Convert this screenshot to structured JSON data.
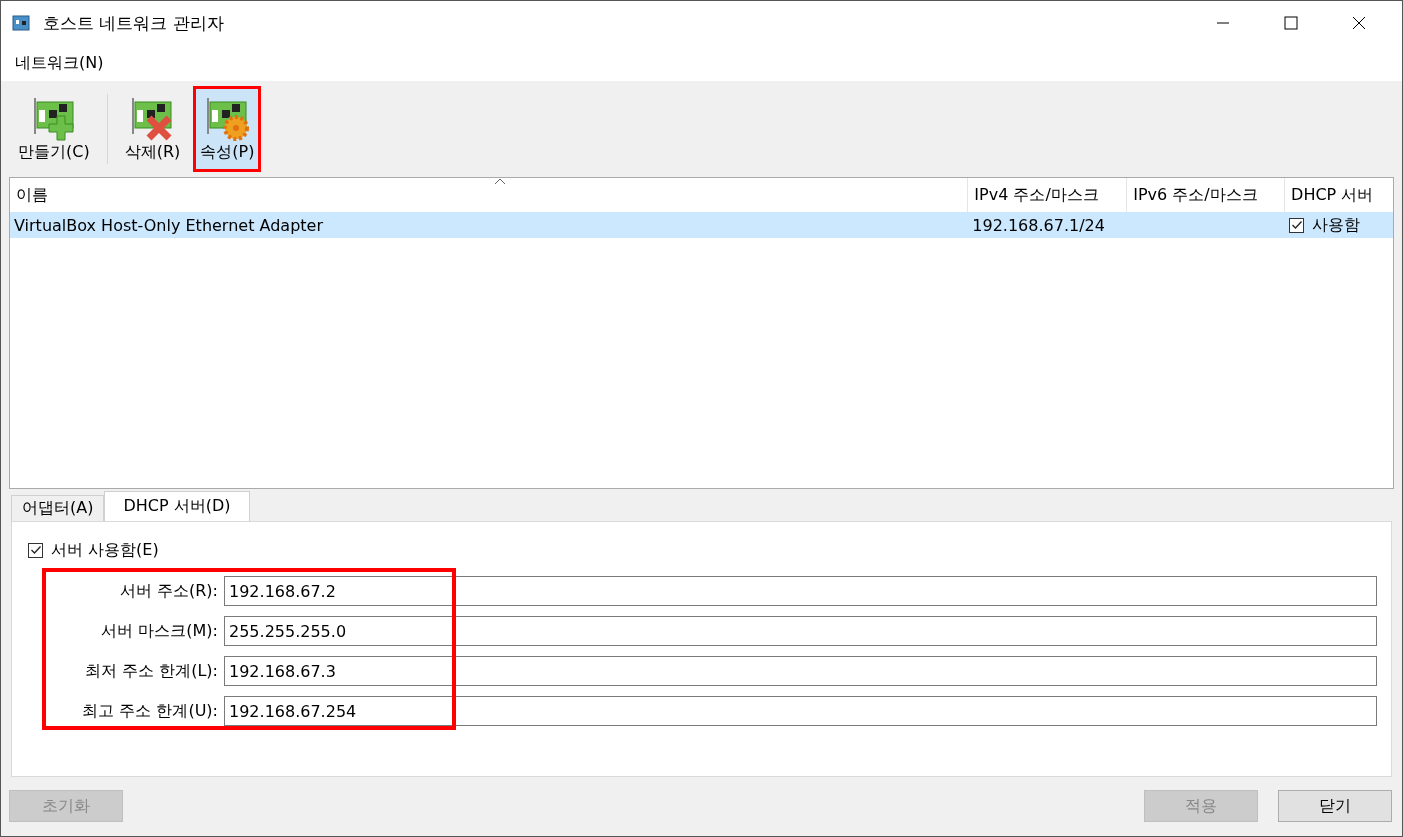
{
  "window": {
    "title": "호스트 네트워크 관리자"
  },
  "menu": [
    "네트워크(N)"
  ],
  "toolbar": [
    {
      "label": "만들기(C)",
      "kind": "create",
      "highlighted": false
    },
    {
      "label": "삭제(R)",
      "kind": "delete",
      "highlighted": false
    },
    {
      "label": "속성(P)",
      "kind": "properties",
      "highlighted": true
    }
  ],
  "table": {
    "columns": [
      "이름",
      "IPv4 주소/마스크",
      "IPv6 주소/마스크",
      "DHCP 서버"
    ],
    "rows": [
      {
        "name": "VirtualBox Host-Only Ethernet Adapter",
        "ipv4": "192.168.67.1/24",
        "ipv6": "",
        "dhcp": {
          "checked": true,
          "label": "사용함"
        },
        "selected": true
      }
    ]
  },
  "tabs": [
    {
      "label": "어댑터(A)",
      "selected": false
    },
    {
      "label": "DHCP 서버(D)",
      "selected": true
    }
  ],
  "dhcp": {
    "enable": {
      "label": "서버 사용함(E)",
      "checked": true
    },
    "highlighted": true,
    "fields": [
      {
        "label": "서버 주소(R):",
        "value": "192.168.67.2"
      },
      {
        "label": "서버 마스크(M):",
        "value": "255.255.255.0"
      },
      {
        "label": "최저 주소 한계(L):",
        "value": "192.168.67.3"
      },
      {
        "label": "최고 주소 한계(U):",
        "value": "192.168.67.254"
      }
    ]
  },
  "buttons_left": [
    {
      "label": "초기화",
      "disabled": true
    }
  ],
  "buttons_right": [
    {
      "label": "적용",
      "disabled": true
    },
    {
      "label": "닫기",
      "disabled": false
    }
  ]
}
